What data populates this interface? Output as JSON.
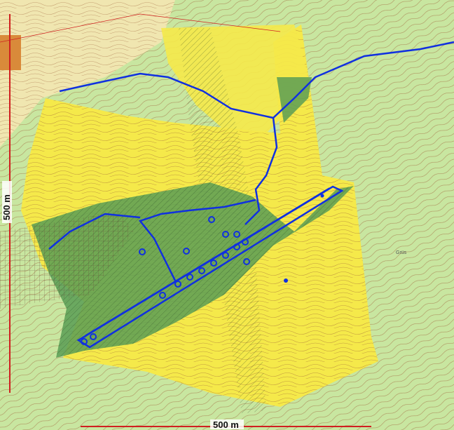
{
  "map": {
    "scale_bar_horizontal": "500 m",
    "scale_bar_vertical": "500 m",
    "place_labels": [
      "Grüs"
    ],
    "colors": {
      "background_green": "#c8e6a0",
      "zone_yellow": "#f5e94a",
      "zone_green_hatched": "#5a9e55",
      "contour_brown": "#9a5a36",
      "stream_blue": "#1030e0",
      "boundary_red": "#d02020",
      "settlement_cream": "#f0e6b0"
    },
    "icons": [
      "settlement-icon",
      "well-marker-icon"
    ]
  }
}
